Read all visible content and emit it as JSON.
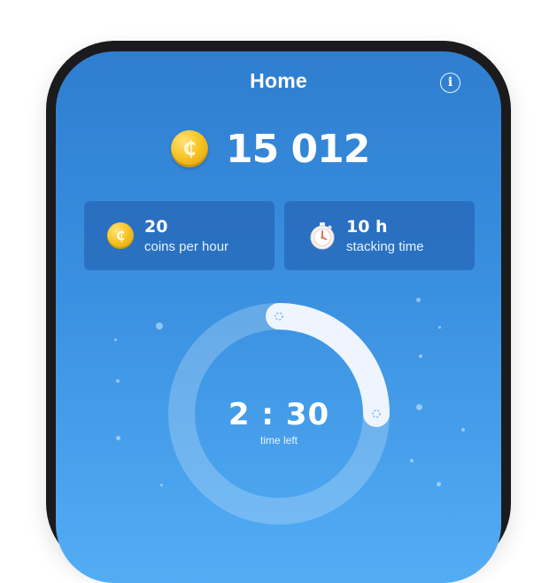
{
  "header": {
    "title": "Home",
    "info_icon": "info-icon"
  },
  "balance": {
    "value": "15 012",
    "coin_symbol": "₵"
  },
  "stats": [
    {
      "value": "20",
      "label": "coins per hour",
      "icon": "coin-icon"
    },
    {
      "value": "10 h",
      "label": "stacking time",
      "icon": "stopwatch-icon"
    }
  ],
  "timer": {
    "value": "2 : 30",
    "label": "time left",
    "progress": 0.25
  },
  "colors": {
    "background_top": "#2f7ed0",
    "background_bottom": "#53adf5",
    "coin": "#f7c524",
    "card": "#194b9b"
  }
}
